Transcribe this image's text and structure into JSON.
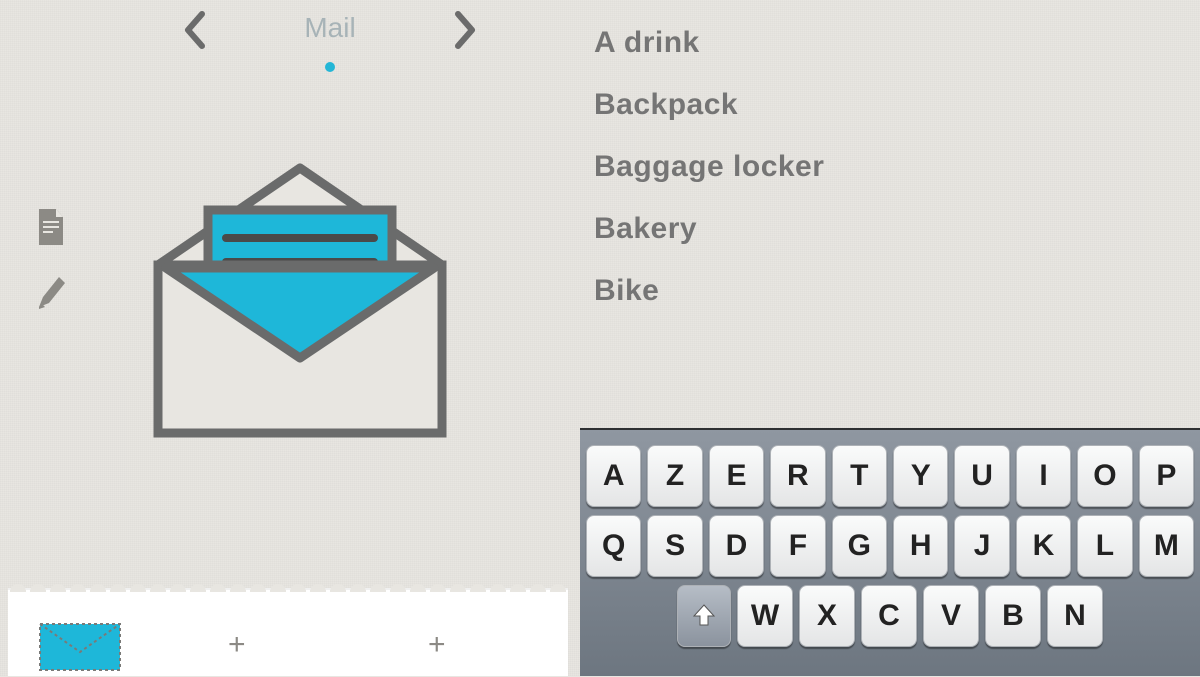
{
  "nav": {
    "title": "Mail"
  },
  "words": [
    "A drink",
    "Backpack",
    "Baggage locker",
    "Bakery",
    "Bike"
  ],
  "keyboard": {
    "row1": [
      "A",
      "Z",
      "E",
      "R",
      "T",
      "Y",
      "U",
      "I",
      "O",
      "P"
    ],
    "row2": [
      "Q",
      "S",
      "D",
      "F",
      "G",
      "H",
      "J",
      "K",
      "L",
      "M"
    ],
    "row3_letters": [
      "W",
      "X",
      "C",
      "V",
      "B",
      "N"
    ]
  },
  "icons": {
    "prev": "chevron-left-icon",
    "next": "chevron-right-icon",
    "document": "document-icon",
    "pencil": "pencil-icon",
    "envelope": "mail-envelope-icon",
    "mini_envelope": "mini-mail-icon",
    "shift": "shift-key-icon"
  },
  "colors": {
    "accent": "#1eb7d9",
    "ink": "#6a6a6a"
  }
}
